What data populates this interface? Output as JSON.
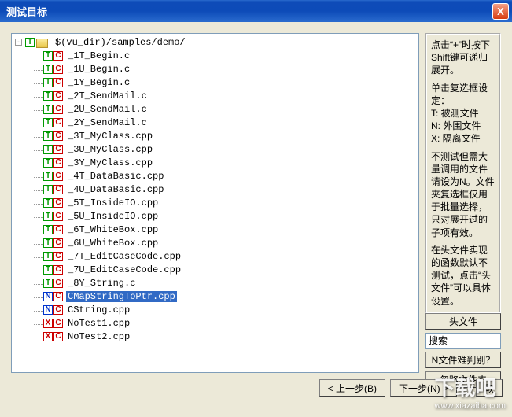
{
  "window": {
    "title": "测试目标",
    "close": "X"
  },
  "tree": {
    "root": {
      "expander": "-",
      "box1": "T",
      "path": "$(vu_dir)/samples/demo/"
    },
    "files": [
      {
        "b1": "T",
        "b2": "C",
        "name": "_1T_Begin.c",
        "sel": false
      },
      {
        "b1": "T",
        "b2": "C",
        "name": "_1U_Begin.c",
        "sel": false
      },
      {
        "b1": "T",
        "b2": "C",
        "name": "_1Y_Begin.c",
        "sel": false
      },
      {
        "b1": "T",
        "b2": "C",
        "name": "_2T_SendMail.c",
        "sel": false
      },
      {
        "b1": "T",
        "b2": "C",
        "name": "_2U_SendMail.c",
        "sel": false
      },
      {
        "b1": "T",
        "b2": "C",
        "name": "_2Y_SendMail.c",
        "sel": false
      },
      {
        "b1": "T",
        "b2": "C",
        "name": "_3T_MyClass.cpp",
        "sel": false
      },
      {
        "b1": "T",
        "b2": "C",
        "name": "_3U_MyClass.cpp",
        "sel": false
      },
      {
        "b1": "T",
        "b2": "C",
        "name": "_3Y_MyClass.cpp",
        "sel": false
      },
      {
        "b1": "T",
        "b2": "C",
        "name": "_4T_DataBasic.cpp",
        "sel": false
      },
      {
        "b1": "T",
        "b2": "C",
        "name": "_4U_DataBasic.cpp",
        "sel": false
      },
      {
        "b1": "T",
        "b2": "C",
        "name": "_5T_InsideIO.cpp",
        "sel": false
      },
      {
        "b1": "T",
        "b2": "C",
        "name": "_5U_InsideIO.cpp",
        "sel": false
      },
      {
        "b1": "T",
        "b2": "C",
        "name": "_6T_WhiteBox.cpp",
        "sel": false
      },
      {
        "b1": "T",
        "b2": "C",
        "name": "_6U_WhiteBox.cpp",
        "sel": false
      },
      {
        "b1": "T",
        "b2": "C",
        "name": "_7T_EditCaseCode.cpp",
        "sel": false
      },
      {
        "b1": "T",
        "b2": "C",
        "name": "_7U_EditCaseCode.cpp",
        "sel": false
      },
      {
        "b1": "T",
        "b2": "C",
        "name": "_8Y_String.c",
        "sel": false
      },
      {
        "b1": "N",
        "b2": "C",
        "name": "CMapStringToPtr.cpp",
        "sel": true
      },
      {
        "b1": "N",
        "b2": "C",
        "name": "CString.cpp",
        "sel": false
      },
      {
        "b1": "X",
        "b2": "C",
        "name": "NoTest1.cpp",
        "sel": false
      },
      {
        "b1": "X",
        "b2": "C",
        "name": "NoTest2.cpp",
        "sel": false
      }
    ]
  },
  "info": {
    "p1": "点击“+”时按下Shift键可递归展开。",
    "p2": "单击复选框设定：",
    "l1": "T: 被测文件",
    "l2": "N: 外围文件",
    "l3": "X: 隔离文件",
    "p3": "不测试但需大量调用的文件请设为N。文件夹复选框仅用于批量选择，只对展开过的子项有效。",
    "p4": "在头文件实现的函数默认不测试，点击“头文件”可以具体设置。"
  },
  "buttons": {
    "header_files": "头文件",
    "search_value": "搜索",
    "n_diff": "N文件难判别？",
    "ignore_folder": "忽略文件夹",
    "back": "< 上一步(B)",
    "next": "下一步(N) >",
    "cancel": "取"
  },
  "watermark": {
    "big": "下载吧",
    "url": "www.xiazaiba.com"
  }
}
